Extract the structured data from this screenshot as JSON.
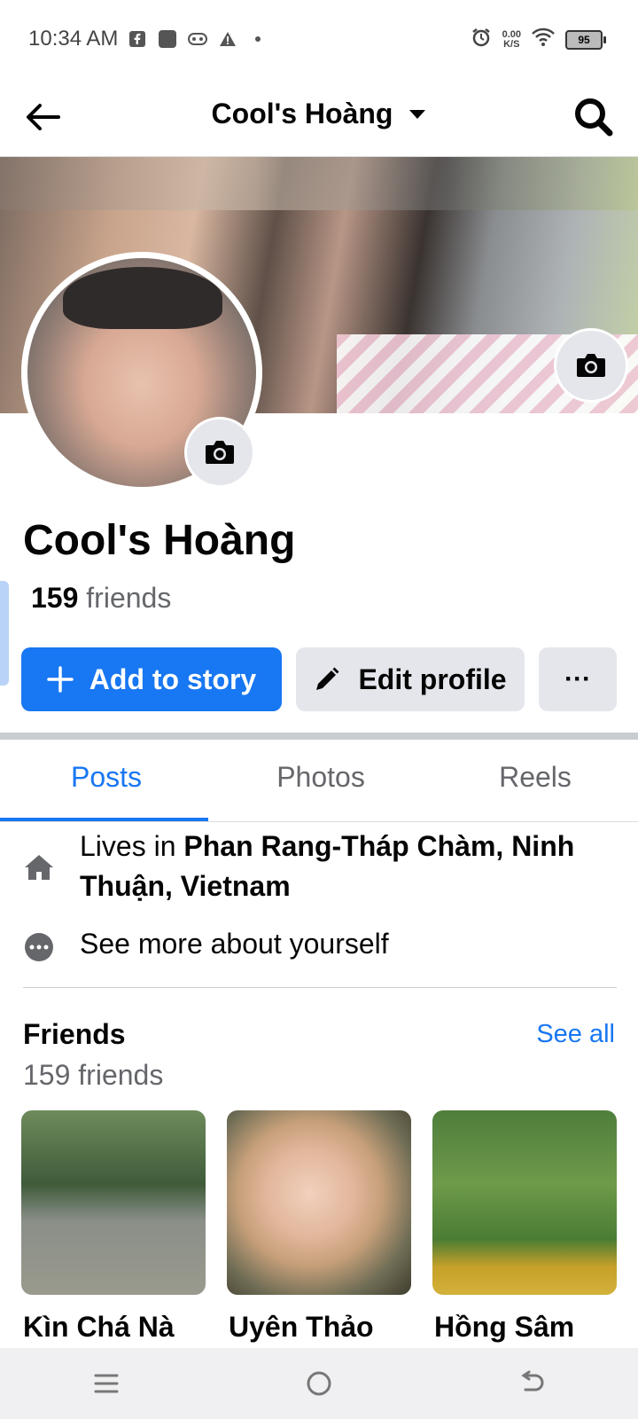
{
  "status_bar": {
    "time": "10:34 AM",
    "speed_value": "0.00",
    "speed_unit": "K/S",
    "battery": "95",
    "icons_left": [
      "facebook-icon",
      "app-square-icon",
      "game-controller-icon",
      "warning-icon",
      "dot-icon"
    ],
    "icons_right": [
      "alarm-icon",
      "wifi-icon",
      "battery-icon"
    ]
  },
  "header": {
    "title": "Cool's Hoàng",
    "back_icon": "back-arrow-icon",
    "dropdown_icon": "caret-down-icon",
    "search_icon": "search-icon"
  },
  "profile": {
    "name": "Cool's Hoàng",
    "friends_count": "159",
    "friends_label": "friends"
  },
  "actions": {
    "add_story": "Add to story",
    "edit_profile": "Edit profile",
    "more": "···"
  },
  "tabs": [
    {
      "label": "Posts",
      "active": true
    },
    {
      "label": "Photos",
      "active": false
    },
    {
      "label": "Reels",
      "active": false
    }
  ],
  "details": {
    "lives_prefix": "Lives in ",
    "lives_place": "Phan Rang-Tháp Chàm, Ninh Thuận, Vietnam",
    "see_more": "See more about yourself"
  },
  "friends": {
    "title": "Friends",
    "see_all": "See all",
    "subtitle": "159 friends",
    "list": [
      {
        "name": "Kìn Chá Nà"
      },
      {
        "name": "Uyên Thảo"
      },
      {
        "name": "Hồng Sâm"
      }
    ]
  },
  "colors": {
    "accent": "#1877f2",
    "button_gray": "#e4e6eb",
    "secondary_text": "#65676b"
  }
}
